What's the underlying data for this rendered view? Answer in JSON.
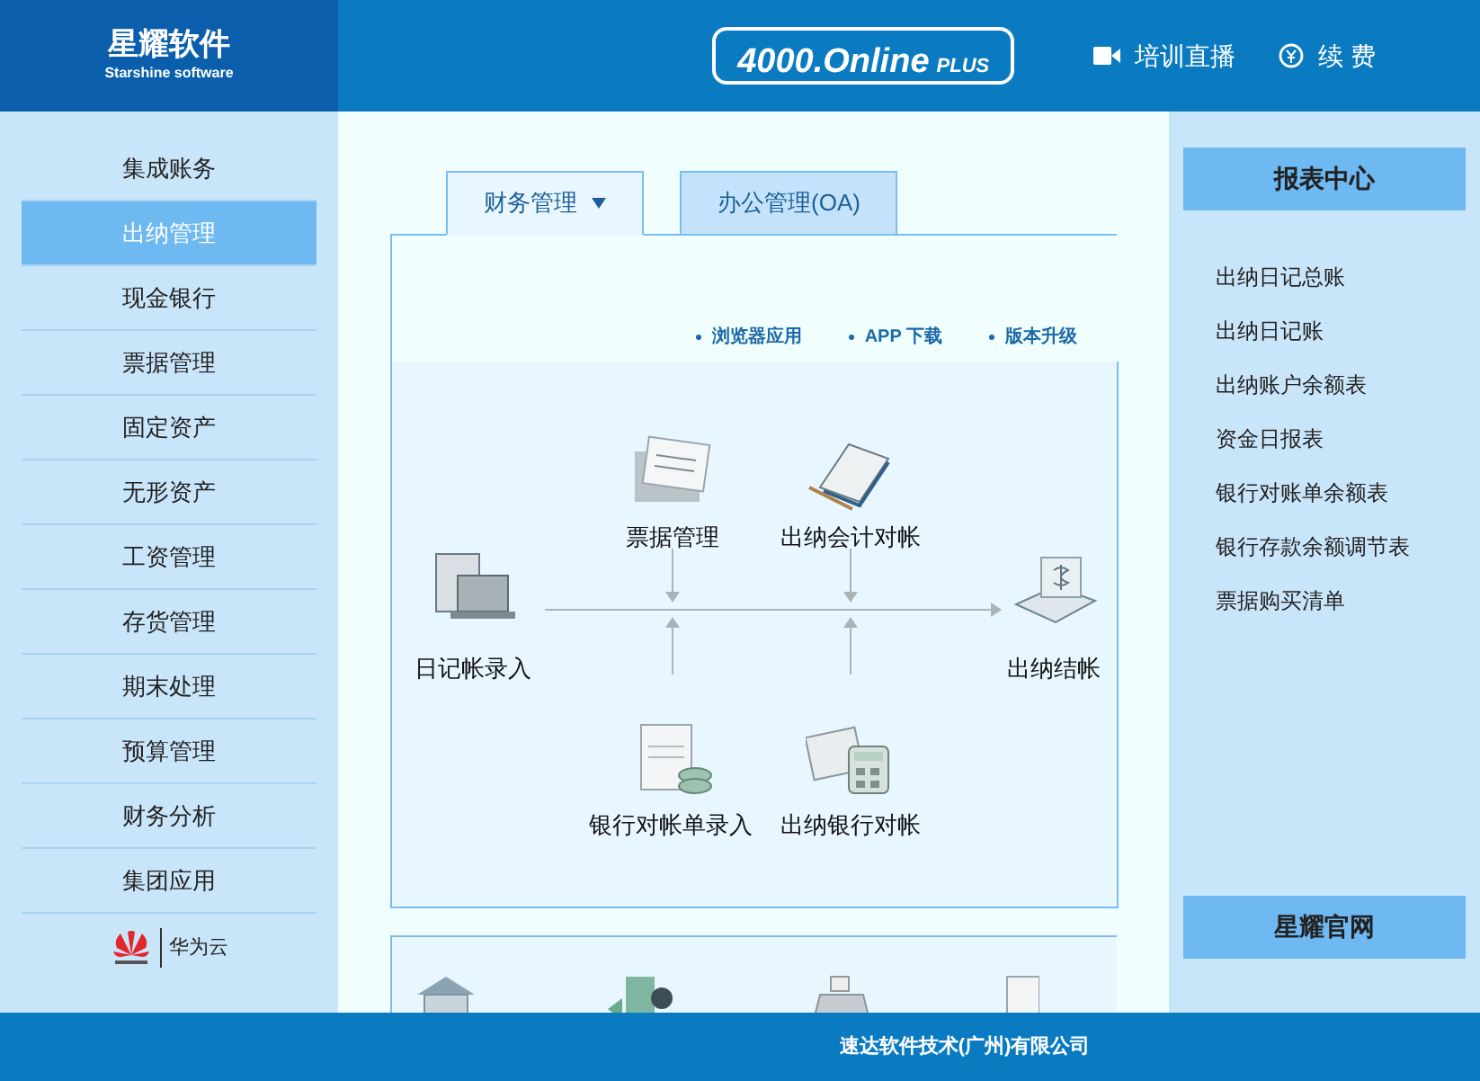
{
  "header": {
    "logo_title": "星耀软件",
    "logo_subtitle": "Starshine software",
    "product": "4000.Online",
    "product_suffix": "PLUS",
    "links": [
      {
        "label": "培训直播"
      },
      {
        "label": "续 费"
      }
    ]
  },
  "sidebar": {
    "items": [
      {
        "label": "集成账务",
        "selected": false
      },
      {
        "label": "出纳管理",
        "selected": true
      },
      {
        "label": "现金银行",
        "selected": false
      },
      {
        "label": "票据管理",
        "selected": false
      },
      {
        "label": "固定资产",
        "selected": false
      },
      {
        "label": "无形资产",
        "selected": false
      },
      {
        "label": "工资管理",
        "selected": false
      },
      {
        "label": "存货管理",
        "selected": false
      },
      {
        "label": "期末处理",
        "selected": false
      },
      {
        "label": "预算管理",
        "selected": false
      },
      {
        "label": "财务分析",
        "selected": false
      },
      {
        "label": "集团应用",
        "selected": false
      }
    ],
    "partner": "华为云"
  },
  "tabs": [
    {
      "label": "财务管理",
      "selected": true
    },
    {
      "label": "办公管理(OA)",
      "selected": false
    }
  ],
  "quick_links": [
    "浏览器应用",
    "APP 下载",
    "版本升级"
  ],
  "flow": {
    "nodes": [
      {
        "label": "票据管理"
      },
      {
        "label": "出纳会计对帐"
      },
      {
        "label": "日记帐录入"
      },
      {
        "label": "出纳结帐"
      },
      {
        "label": "银行对帐单录入"
      },
      {
        "label": "出纳银行对帐"
      }
    ]
  },
  "report_center": {
    "title": "报表中心",
    "items": [
      "出纳日记总账",
      "出纳日记账",
      "出纳账户余额表",
      "资金日报表",
      "银行对账单余额表",
      "银行存款余额调节表",
      "票据购买清单"
    ],
    "website_button": "星耀官网"
  },
  "footer": "速达软件技术(广州)有限公司"
}
